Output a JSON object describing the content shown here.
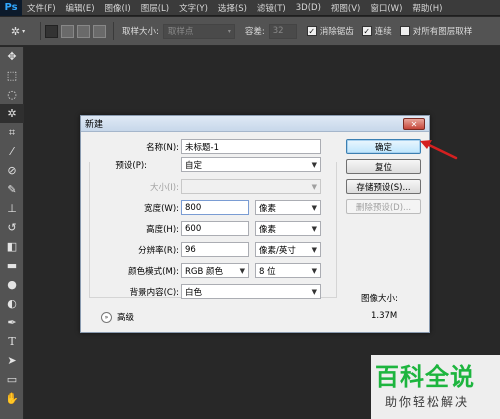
{
  "app": {
    "logo": "Ps",
    "menu": [
      "文件(F)",
      "编辑(E)",
      "图像(I)",
      "图层(L)",
      "文字(Y)",
      "选择(S)",
      "滤镜(T)",
      "3D(D)",
      "视图(V)",
      "窗口(W)",
      "帮助(H)"
    ]
  },
  "options_bar": {
    "sample_size_label": "取样大小:",
    "sample_size_value": "取样点",
    "tolerance_label": "容差:",
    "tolerance_value": "32",
    "antialias_label": "消除锯齿",
    "contiguous_label": "连续",
    "all_layers_label": "对所有图层取样"
  },
  "toolbar": {
    "tools": [
      "move-icon",
      "marquee-icon",
      "lasso-icon",
      "magic-wand-icon",
      "crop-icon",
      "eyedropper-icon",
      "healing-brush-icon",
      "brush-icon",
      "clone-stamp-icon",
      "history-brush-icon",
      "eraser-icon",
      "gradient-icon",
      "blur-icon",
      "dodge-icon",
      "pen-icon",
      "type-icon",
      "path-selection-icon",
      "shape-icon",
      "hand-icon"
    ]
  },
  "dialog": {
    "title": "新建",
    "close_label": "✕",
    "name_label": "名称(N):",
    "name_value": "未标题-1",
    "preset_label": "预设(P):",
    "preset_value": "自定",
    "size_label": "大小(I):",
    "size_value": "",
    "width_label": "宽度(W):",
    "width_value": "800",
    "width_unit": "像素",
    "height_label": "高度(H):",
    "height_value": "600",
    "height_unit": "像素",
    "resolution_label": "分辨率(R):",
    "resolution_value": "96",
    "resolution_unit": "像素/英寸",
    "color_mode_label": "颜色模式(M):",
    "color_mode_value": "RGB 颜色",
    "bit_depth_value": "8 位",
    "background_label": "背景内容(C):",
    "background_value": "白色",
    "advanced_label": "高级",
    "ok_label": "确定",
    "reset_label": "复位",
    "save_preset_label": "存储预设(S)...",
    "delete_preset_label": "删除预设(D)...",
    "image_size_label": "图像大小:",
    "image_size_value": "1.37M"
  },
  "watermark": {
    "title": "百科全说",
    "subtitle": "助你轻松解决"
  },
  "colors": {
    "accent_arrow": "#d42020",
    "watermark_green": "#1db53e"
  }
}
